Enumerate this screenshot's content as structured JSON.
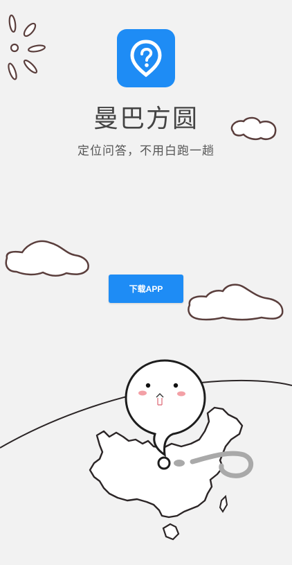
{
  "app": {
    "name": "曼巴方圆",
    "tagline": "定位问答，不用白跑一趟",
    "icon": "location-pin-question-icon",
    "accent_color": "#1e8cf5"
  },
  "actions": {
    "download_label": "下载APP"
  },
  "illustration": {
    "background_color": "#f2f2f2",
    "line_color": "#2b2526",
    "shadow_color": "#a9a9a9",
    "blush_color": "#f3a0a6"
  }
}
